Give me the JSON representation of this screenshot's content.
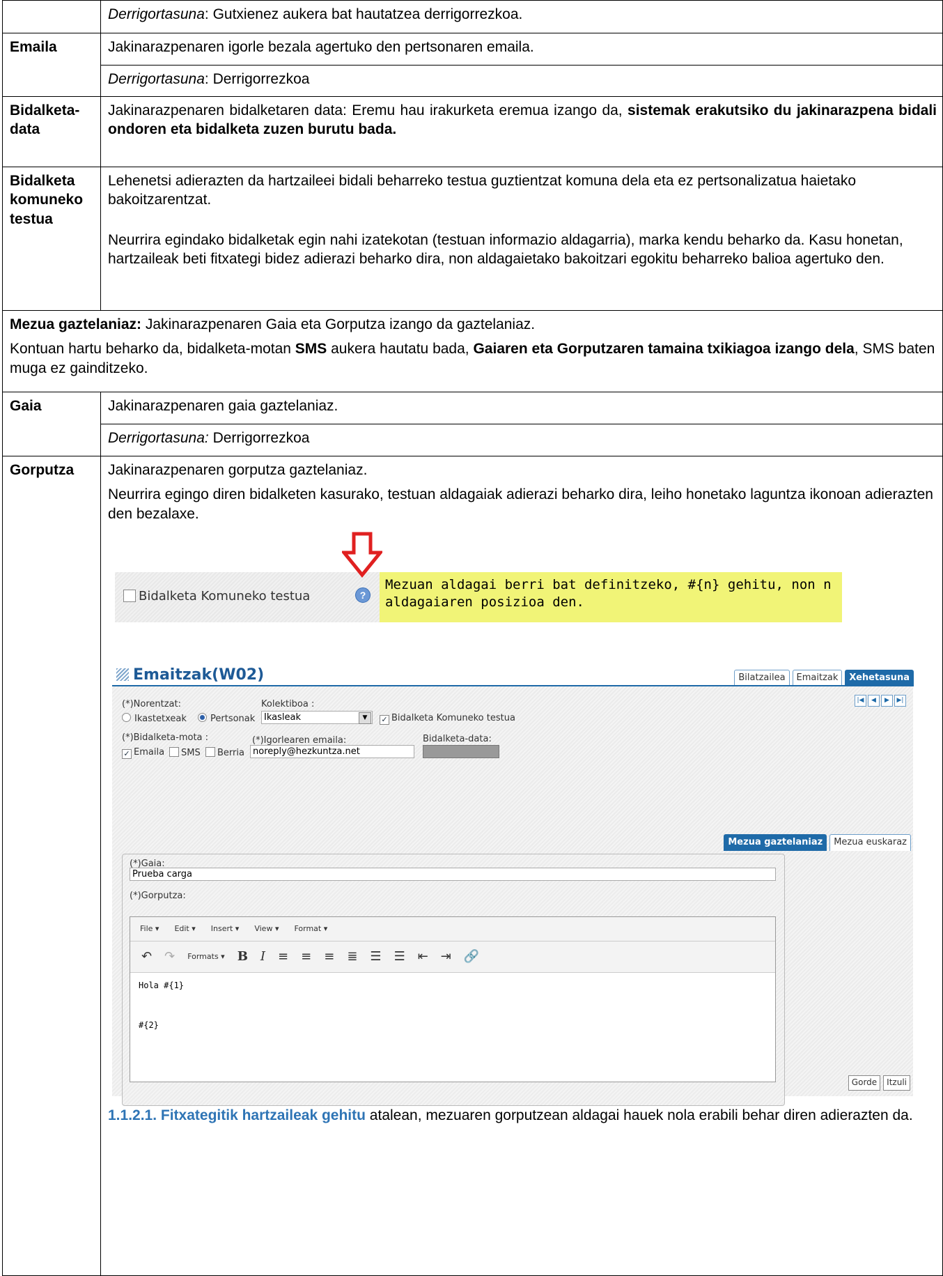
{
  "rows": {
    "r0": {
      "label": "",
      "italic": "Derrigortasuna",
      "text": ": Gutxienez aukera bat hautatzea derrigorrezkoa."
    },
    "emaila": {
      "label": "Emaila",
      "desc": "Jakinarazpenaren igorle bezala agertuko den pertsonaren emaila.",
      "req_italic": "Derrigortasuna",
      "req_text": ": Derrigorrezkoa"
    },
    "bdata": {
      "label": "Bidalketa-data",
      "text": "Jakinarazpenaren bidalketaren data: Eremu hau irakurketa eremua izango da, ",
      "bold": "sistemak erakutsiko du jakinarazpena bidali ondoren eta bidalketa zuzen burutu bada."
    },
    "komun": {
      "label": "Bidalketa komuneko testua",
      "p1": "Lehenetsi adierazten da hartzaileei bidali beharreko testua guztientzat komuna dela eta ez pertsonalizatua haietako bakoitzarentzat.",
      "p2": "Neurrira egindako bidalketak egin nahi izatekotan (testuan informazio aldagarria), marka kendu beharko da. Kasu honetan, hartzaileak beti  fitxategi bidez adierazi beharko dira, non aldagaietako bakoitzari egokitu beharreko balioa agertuko den."
    },
    "mezua": {
      "b1": "Mezua gaztelaniaz:",
      "t1": " Jakinarazpenaren Gaia eta Gorputza izango da gaztelaniaz.",
      "t2": "Kontuan hartu beharko da, bidalketa-motan ",
      "b2": "SMS",
      "t3": " aukera hautatu bada, ",
      "b3": "Gaiaren eta Gorputzaren tamaina txikiagoa izango dela",
      "t4": ", SMS baten muga ez gainditzeko."
    },
    "gaia": {
      "label": "Gaia",
      "desc": "Jakinarazpenaren gaia gaztelaniaz.",
      "req_italic": "Derrigortasuna:",
      "req_text": " Derrigorrezkoa"
    },
    "gorputza": {
      "label": "Gorputza",
      "p1": "Jakinarazpenaren gorputza gaztelaniaz.",
      "p2": "Neurrira egingo diren bidalketen kasurako, testuan aldagaiak adierazi beharko dira, leiho honetako laguntza ikonoan adierazten den bezalaxe.",
      "link": "1.1.2.1. Fitxategitik hartzaileak gehitu",
      "after": " atalean, mezuaren gorputzean aldagai hauek nola erabili behar diren adierazten da."
    }
  },
  "tooltip_shot": {
    "checkbox_label": "Bidalketa Komuneko testua",
    "tooltip": "Mezuan aldagai berri bat definitzeko, #{n} gehitu, non n aldagaiaren posizioa den.",
    "arrow_color": "#e02020",
    "tooltip_bg": "#f1f477"
  },
  "form_shot": {
    "title": "Emaitzak(W02)",
    "tabs": [
      "Bilatzailea",
      "Emaitzak",
      "Xehetasuna"
    ],
    "norentzat_label": "(*)Norentzat:",
    "radio1": "Ikastetxeak",
    "radio2": "Pertsonak",
    "kolektiboa_label": "Kolektiboa :",
    "kolektiboa_value": "Ikasleak",
    "komun_check": "Bidalketa Komuneko testua",
    "mota_label": "(*)Bidalketa-mota :",
    "mota_emaila": "Emaila",
    "mota_sms": "SMS",
    "mota_berria": "Berria",
    "igorle_label": "(*)Igorlearen emaila:",
    "igorle_value": "noreply@hezkuntza.net",
    "data_label": "Bidalketa-data:",
    "subtabs": [
      "Mezua gaztelaniaz",
      "Mezua euskaraz"
    ],
    "gaia_label": "(*)Gaia:",
    "gaia_value": "Prueba carga",
    "gorputza_label": "(*)Gorputza:",
    "menu": [
      "File ▾",
      "Edit ▾",
      "Insert ▾",
      "View ▾",
      "Format ▾"
    ],
    "formats": "Formats ▾",
    "body_line1": "Hola #{1}",
    "body_line2": "#{2}",
    "buttons": [
      "Gorde",
      "Itzuli"
    ],
    "accent": "#1e6aa8"
  }
}
